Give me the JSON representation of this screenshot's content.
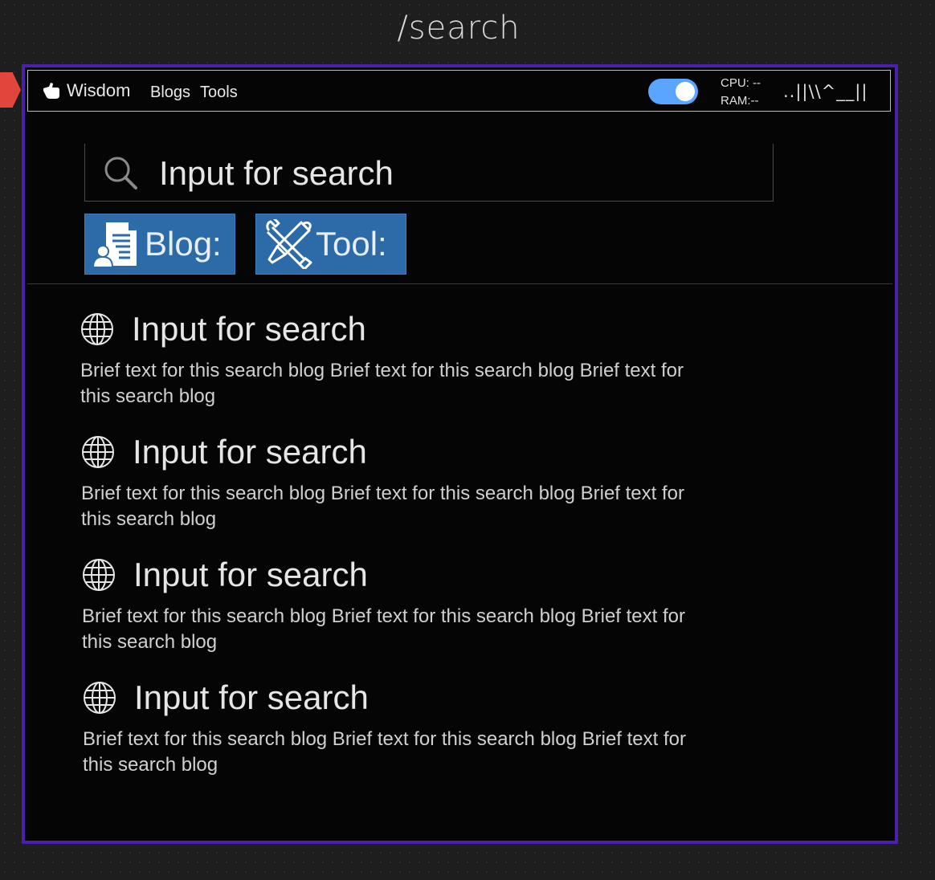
{
  "page": {
    "route_title": "/search"
  },
  "topbar": {
    "brand": "Wisdom",
    "nav": [
      {
        "label": "Blogs"
      },
      {
        "label": "Tools"
      }
    ],
    "toggle": {
      "state": "on",
      "color": "#5aa5ff"
    },
    "stats": {
      "cpu": "CPU: --",
      "ram": "RAM:--"
    },
    "signal_text": "..||\\\\^__||"
  },
  "search": {
    "value": "",
    "placeholder": "Input for search",
    "icon": "search-icon"
  },
  "filters": [
    {
      "label": "Blog:",
      "icon": "blog-document-icon"
    },
    {
      "label": "Tool:",
      "icon": "tools-icon"
    }
  ],
  "results": [
    {
      "title": "Input for search",
      "text": "Brief text for this search blog Brief text for this search blog Brief text for this search blog",
      "icon": "globe-icon"
    },
    {
      "title": "Input for search",
      "text": "Brief text for this search blog Brief text for this search blog Brief text for this search blog",
      "icon": "globe-icon"
    },
    {
      "title": "Input for search",
      "text": "Brief text for this search blog Brief text for this search blog Brief text for this search blog",
      "icon": "globe-icon"
    },
    {
      "title": "Input for search",
      "text": "Brief text for this search blog Brief text for this search blog Brief text for this search blog",
      "icon": "globe-icon"
    }
  ],
  "colors": {
    "frame": "#4d1fae",
    "filter_button": "#2c6aa8",
    "marker": "#e2453c",
    "background": "#050505"
  }
}
